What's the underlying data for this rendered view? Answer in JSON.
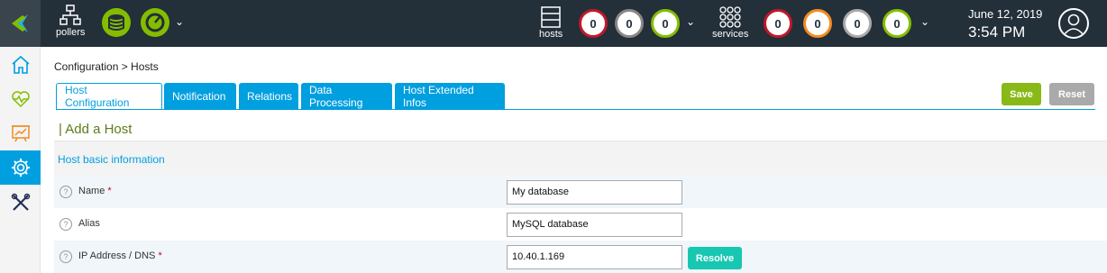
{
  "topbar": {
    "pollers_label": "pollers",
    "hosts_label": "hosts",
    "services_label": "services",
    "host_counters": [
      {
        "value": "0",
        "color": "#c0182b"
      },
      {
        "value": "0",
        "color": "#888888"
      },
      {
        "value": "0",
        "color": "#84bd00"
      }
    ],
    "service_counters": [
      {
        "value": "0",
        "color": "#c0182b"
      },
      {
        "value": "0",
        "color": "#f28c21"
      },
      {
        "value": "0",
        "color": "#aaaaaa"
      },
      {
        "value": "0",
        "color": "#84bd00"
      }
    ],
    "date": "June 12, 2019",
    "time": "3:54 PM"
  },
  "sidebar": {
    "items": [
      {
        "icon": "home-icon",
        "active": false
      },
      {
        "icon": "heartbeat-icon",
        "active": false
      },
      {
        "icon": "chart-board-icon",
        "active": false
      },
      {
        "icon": "gear-icon",
        "active": true
      },
      {
        "icon": "tools-icon",
        "active": false
      }
    ]
  },
  "breadcrumb": {
    "text": "Configuration  >  Hosts"
  },
  "tabs": [
    {
      "label": "Host Configuration",
      "active": true
    },
    {
      "label": "Notification",
      "active": false
    },
    {
      "label": "Relations",
      "active": false
    },
    {
      "label": "Data Processing",
      "active": false
    },
    {
      "label": "Host Extended Infos",
      "active": false
    }
  ],
  "actions": {
    "save": "Save",
    "reset": "Reset"
  },
  "form": {
    "title": "| Add a Host",
    "section": "Host basic information",
    "fields": [
      {
        "label": "Name",
        "required": "*",
        "value": "My database"
      },
      {
        "label": "Alias",
        "required": "",
        "value": "MySQL database"
      },
      {
        "label": "IP Address / DNS",
        "required": "*",
        "value": "10.40.1.169"
      }
    ],
    "resolve": "Resolve",
    "help_glyph": "?"
  },
  "colors": {
    "accent": "#009fdf",
    "save": "#88b917",
    "resolve": "#17c7b1",
    "topbar": "#232f39"
  }
}
